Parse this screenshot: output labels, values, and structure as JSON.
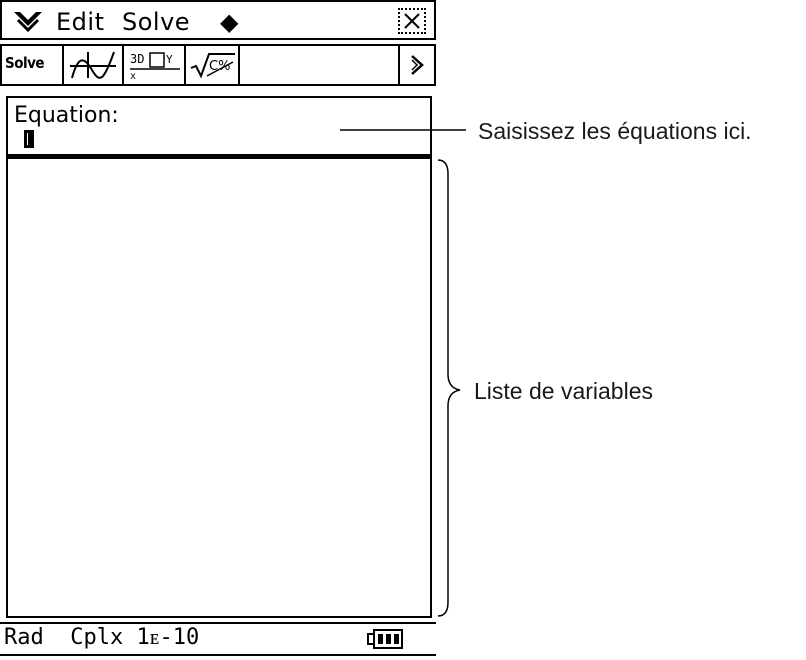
{
  "menubar": {
    "menu_icon": "menu-chevron-icon",
    "edit_label": "Edit",
    "solve_label": "Solve",
    "diamond_label": "◆",
    "close_icon": "close-icon"
  },
  "toolbar": {
    "solve_label": "Solve",
    "graph_icon": "graph-icon",
    "table_icon": "table-3d-icon",
    "sqrt_icon": "sqrt-icon",
    "scroll_icon": "scroll-right-icon"
  },
  "equation": {
    "label": "Equation:"
  },
  "status": {
    "text": "Rad  Cplx 1ᴇ-10"
  },
  "annotations": {
    "equation_hint": "Saisissez les équations ici.",
    "variable_list": "Liste de variables"
  }
}
